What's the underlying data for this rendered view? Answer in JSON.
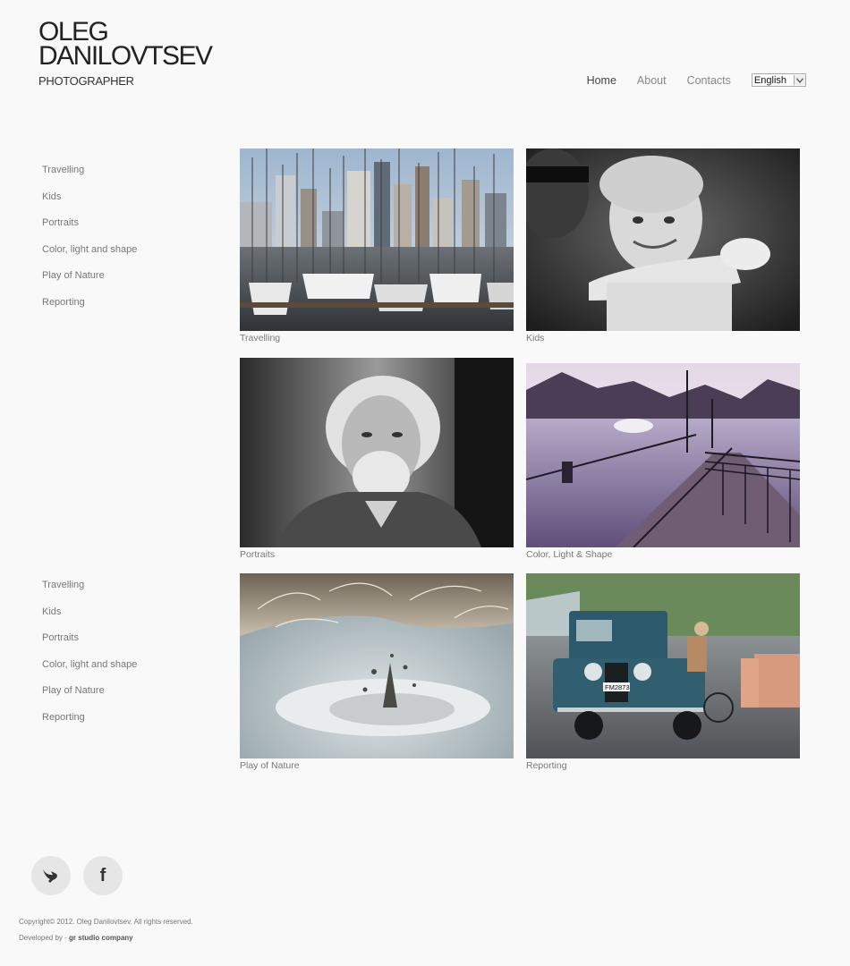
{
  "logo": {
    "line1": "OLEG",
    "line2": "DANILOVTSEV",
    "line3": "PHOTOGRAPHER"
  },
  "nav": {
    "home": "Home",
    "about": "About",
    "contacts": "Contacts",
    "language": "English"
  },
  "side_menu_top": [
    "Travelling",
    "Kids",
    "Portraits",
    "Color, light and shape",
    "Play of Nature",
    "Reporting"
  ],
  "side_menu_bottom": [
    "Travelling",
    "Kids",
    "Portraits",
    "Color, light and shape",
    "Play of Nature",
    "Reporting"
  ],
  "gallery": [
    {
      "caption": "Travelling"
    },
    {
      "caption": "Kids"
    },
    {
      "caption": "Portraits"
    },
    {
      "caption": "Color, Light & Shape"
    },
    {
      "caption": "Play of Nature"
    },
    {
      "caption": "Reporting"
    }
  ],
  "car_plate": "FM2873",
  "footer": {
    "copyright": "Copyright© 2012. Oleg Danilovtsev. All rights reserved.",
    "developed_prefix": "Developed by -",
    "developer": "gr studio company"
  },
  "colors": {
    "background": "#f9f9f9",
    "text": "#777777",
    "heading": "#222222"
  }
}
